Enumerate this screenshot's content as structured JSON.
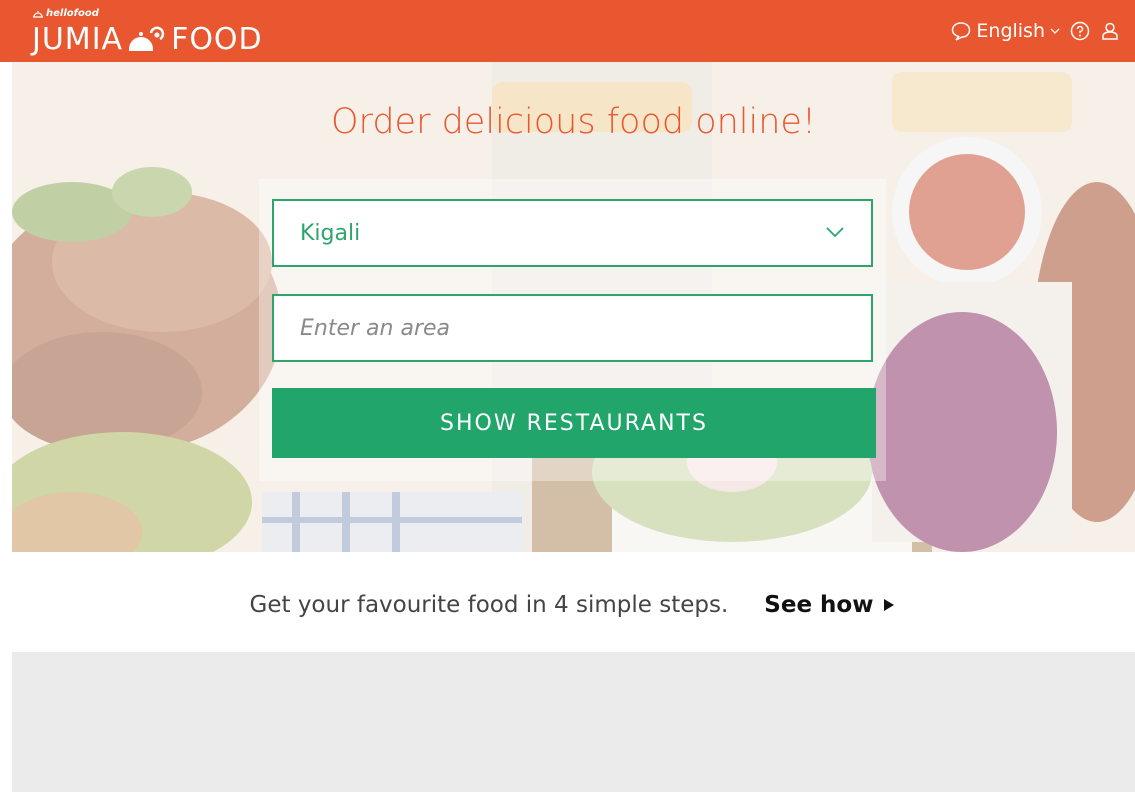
{
  "header": {
    "logo_small": "hellofood",
    "logo_left": "JUMIA",
    "logo_right": "FOOD",
    "language": "English",
    "icons": [
      "chat-icon",
      "chevron-down-icon",
      "help-icon",
      "user-icon"
    ],
    "bg_color": "#e8572f"
  },
  "hero": {
    "title": "Order delicious food online!",
    "city": {
      "selected": "Kigali"
    },
    "area": {
      "value": "",
      "placeholder": "Enter an area"
    },
    "cta_label": "SHOW RESTAURANTS",
    "accent_color": "#21a56a"
  },
  "steps": {
    "text": "Get your favourite food in 4 simple steps.",
    "link_label": "See how"
  }
}
